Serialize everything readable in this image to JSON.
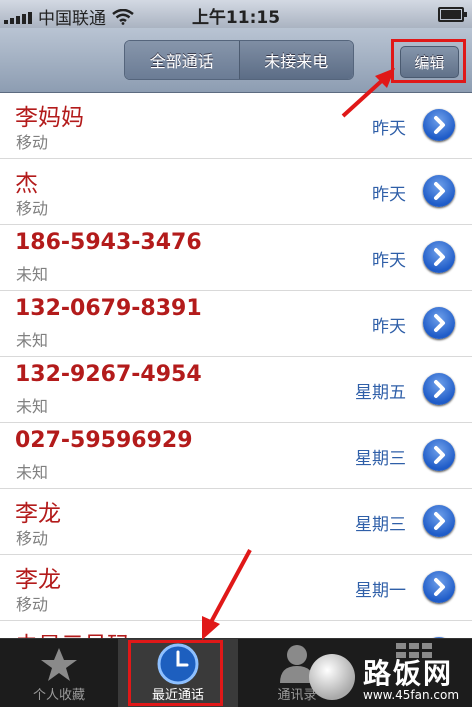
{
  "status_bar": {
    "carrier": "中国联通",
    "time": "上午11:15"
  },
  "nav": {
    "segment_all": "全部通话",
    "segment_missed": "未接来电",
    "edit": "编辑"
  },
  "calls": [
    {
      "name": "李妈妈",
      "type": "移动",
      "when": "昨天"
    },
    {
      "name": "杰",
      "type": "移动",
      "when": "昨天"
    },
    {
      "name": "186-5943-3476",
      "type": "未知",
      "when": "昨天"
    },
    {
      "name": "132-0679-8391",
      "type": "未知",
      "when": "昨天"
    },
    {
      "name": "132-9267-4954",
      "type": "未知",
      "when": "星期五"
    },
    {
      "name": "027-59596929",
      "type": "未知",
      "when": "星期三"
    },
    {
      "name": "李龙",
      "type": "移动",
      "when": "星期三"
    },
    {
      "name": "李龙",
      "type": "移动",
      "when": "星期一"
    },
    {
      "name": "未显示号码",
      "type": "",
      "when": ""
    }
  ],
  "tabs": {
    "favorites": "个人收藏",
    "recents": "最近通话",
    "contacts": "通讯录"
  },
  "watermark": {
    "text": "路饭网",
    "url": "www.45fan.com"
  },
  "colors": {
    "name_red": "#b31b1b",
    "time_blue": "#2f5fa8",
    "annotation_red": "#e01818"
  }
}
